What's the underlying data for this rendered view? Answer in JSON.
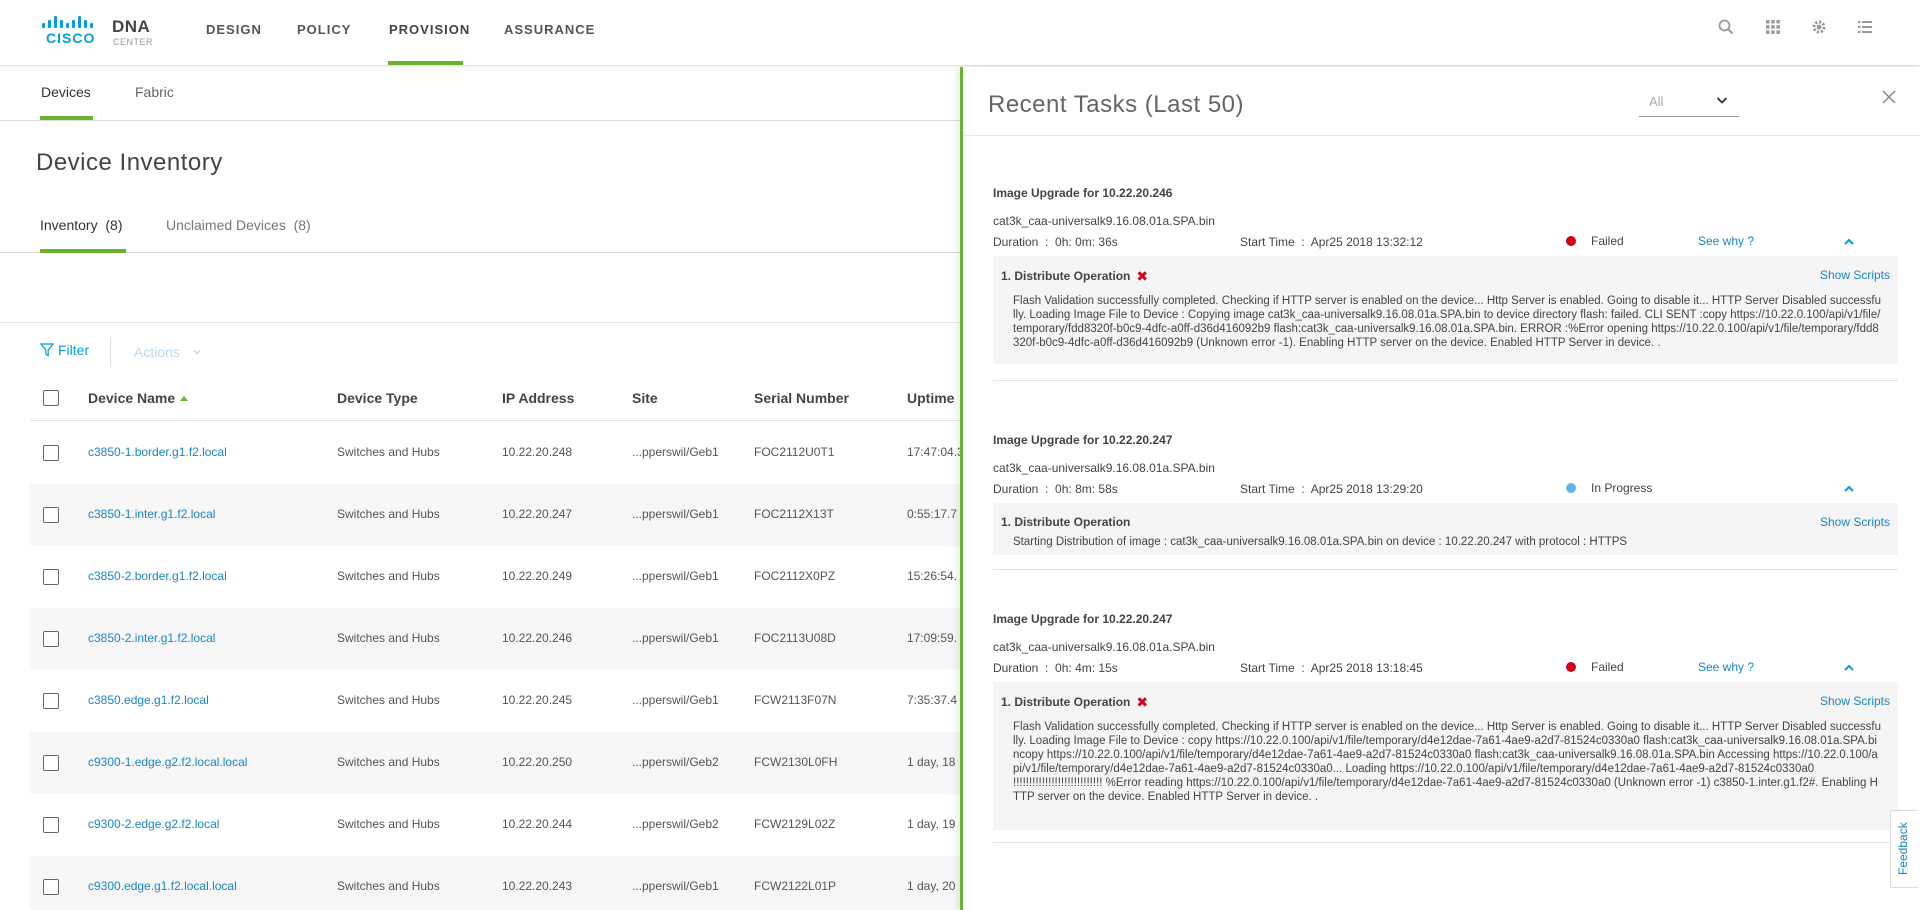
{
  "brand": {
    "cisco": "CISCO",
    "product": "DNA",
    "sub": "CENTER"
  },
  "nav": {
    "items": [
      "DESIGN",
      "POLICY",
      "PROVISION",
      "ASSURANCE"
    ],
    "active": "PROVISION"
  },
  "top_icons": [
    "search-icon",
    "apps-grid-icon",
    "gear-icon",
    "list-icon"
  ],
  "subtabs": [
    "Devices",
    "Fabric"
  ],
  "page": {
    "title": "Device Inventory"
  },
  "inventory_tabs": [
    {
      "label": "Inventory",
      "count": "(8)"
    },
    {
      "label": "Unclaimed Devices",
      "count": "(8)"
    }
  ],
  "toolbar": {
    "filter": "Filter",
    "actions": "Actions"
  },
  "table": {
    "headers": [
      "Device Name",
      "Device Type",
      "IP Address",
      "Site",
      "Serial Number",
      "Uptime"
    ],
    "rows": [
      {
        "name": "c3850-1.border.g1.f2.local",
        "type": "Switches and Hubs",
        "ip": "10.22.20.248",
        "site": "...pperswil/Geb1",
        "serial": "FOC2112U0T1",
        "uptime": "17:47:04.3"
      },
      {
        "name": "c3850-1.inter.g1.f2.local",
        "type": "Switches and Hubs",
        "ip": "10.22.20.247",
        "site": "...pperswil/Geb1",
        "serial": "FOC2112X13T",
        "uptime": "0:55:17.7"
      },
      {
        "name": "c3850-2.border.g1.f2.local",
        "type": "Switches and Hubs",
        "ip": "10.22.20.249",
        "site": "...pperswil/Geb1",
        "serial": "FOC2112X0PZ",
        "uptime": "15:26:54."
      },
      {
        "name": "c3850-2.inter.g1.f2.local",
        "type": "Switches and Hubs",
        "ip": "10.22.20.246",
        "site": "...pperswil/Geb1",
        "serial": "FOC2113U08D",
        "uptime": "17:09:59."
      },
      {
        "name": "c3850.edge.g1.f2.local",
        "type": "Switches and Hubs",
        "ip": "10.22.20.245",
        "site": "...pperswil/Geb1",
        "serial": "FCW2113F07N",
        "uptime": "7:35:37.4"
      },
      {
        "name": "c9300-1.edge.g2.f2.local.local",
        "type": "Switches and Hubs",
        "ip": "10.22.20.250",
        "site": "...pperswil/Geb2",
        "serial": "FCW2130L0FH",
        "uptime": "1 day, 18"
      },
      {
        "name": "c9300-2.edge.g2.f2.local",
        "type": "Switches and Hubs",
        "ip": "10.22.20.244",
        "site": "...pperswil/Geb2",
        "serial": "FCW2129L02Z",
        "uptime": "1 day, 19"
      },
      {
        "name": "c9300.edge.g1.f2.local.local",
        "type": "Switches and Hubs",
        "ip": "10.22.20.243",
        "site": "...pperswil/Geb1",
        "serial": "FCW2122L01P",
        "uptime": "1 day, 20"
      }
    ]
  },
  "panel": {
    "title": "Recent Tasks (Last 50)",
    "filter_value": "All",
    "labels": {
      "duration": "Duration",
      "start_time": "Start Time",
      "see_why": "See why ?",
      "show_scripts": "Show Scripts",
      "colon": ":"
    },
    "tasks": [
      {
        "title": "Image Upgrade for 10.22.20.246",
        "image": "cat3k_caa-universalk9.16.08.01a.SPA.bin",
        "duration": "0h: 0m: 36s",
        "start": "Apr25 2018 13:32:12",
        "status": "Failed",
        "status_color": "#d0021b",
        "operation": "1. Distribute Operation",
        "details": "Flash Validation successfully completed. Checking if HTTP server is enabled on the device... Http Server is enabled. Going to disable it... HTTP Server Disabled successfully. Loading Image File to Device : Copying image cat3k_caa-universalk9.16.08.01a.SPA.bin to device directory flash: failed. CLI SENT :copy https://10.22.0.100/api/v1/file/temporary/fdd8320f-b0c9-4dfc-a0ff-d36d416092b9 flash:cat3k_caa-universalk9.16.08.01a.SPA.bin. ERROR :%Error opening https://10.22.0.100/api/v1/file/temporary/fdd8320f-b0c9-4dfc-a0ff-d36d416092b9 (Unknown error -1). Enabling HTTP server on the device. Enabled HTTP Server in device. ."
      },
      {
        "title": "Image Upgrade for 10.22.20.247",
        "image": "cat3k_caa-universalk9.16.08.01a.SPA.bin",
        "duration": "0h: 8m: 58s",
        "start": "Apr25 2018 13:29:20",
        "status": "In Progress",
        "status_color": "#64b5e6",
        "operation": "1. Distribute Operation",
        "details": "Starting Distribution of image : cat3k_caa-universalk9.16.08.01a.SPA.bin on device : 10.22.20.247 with protocol : HTTPS"
      },
      {
        "title": "Image Upgrade for 10.22.20.247",
        "image": "cat3k_caa-universalk9.16.08.01a.SPA.bin",
        "duration": "0h: 4m: 15s",
        "start": "Apr25 2018 13:18:45",
        "status": "Failed",
        "status_color": "#d0021b",
        "operation": "1. Distribute Operation",
        "details": "Flash Validation successfully completed. Checking if HTTP server is enabled on the device... Http Server is enabled. Going to disable it... HTTP Server Disabled successfully. Loading Image File to Device : copy https://10.22.0.100/api/v1/file/temporary/d4e12dae-7a61-4ae9-a2d7-81524c0330a0 flash:cat3k_caa-universalk9.16.08.01a.SPA.bincopy https://10.22.0.100/api/v1/file/temporary/d4e12dae-7a61-4ae9-a2d7-81524c0330a0 flash:cat3k_caa-universalk9.16.08.01a.SPA.bin Accessing https://10.22.0.100/api/v1/file/temporary/d4e12dae-7a61-4ae9-a2d7-81524c0330a0... Loading https://10.22.0.100/api/v1/file/temporary/d4e12dae-7a61-4ae9-a2d7-81524c0330a0 !!!!!!!!!!!!!!!!!!!!!!!!!!!! %Error reading https://10.22.0.100/api/v1/file/temporary/d4e12dae-7a61-4ae9-a2d7-81524c0330a0 (Unknown error -1) c3850-1.inter.g1.f2#. Enabling HTTP server on the device. Enabled HTTP Server in device. ."
      }
    ]
  },
  "feedback": "Feedback"
}
